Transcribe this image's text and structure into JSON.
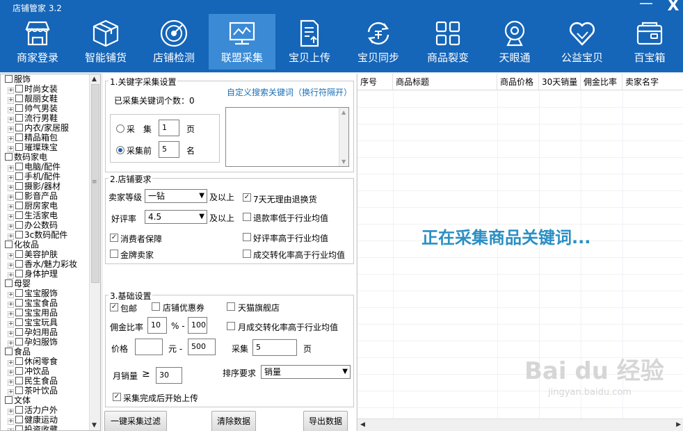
{
  "app": {
    "title": "店铺管家  3.2",
    "minimize": "—",
    "close": "X"
  },
  "toolbar": [
    {
      "label": "商家登录",
      "icon": "shop-icon"
    },
    {
      "label": "智能铺货",
      "icon": "box-icon"
    },
    {
      "label": "店铺检测",
      "icon": "radar-icon"
    },
    {
      "label": "联盟采集",
      "icon": "monitor-chart-icon",
      "active": true
    },
    {
      "label": "宝贝上传",
      "icon": "document-upload-icon"
    },
    {
      "label": "宝贝同步",
      "icon": "sync-icon"
    },
    {
      "label": "商品裂变",
      "icon": "grid-icon"
    },
    {
      "label": "天眼通",
      "icon": "webcam-icon"
    },
    {
      "label": "公益宝贝",
      "icon": "heart-icon"
    },
    {
      "label": "百宝箱",
      "icon": "wallet-icon"
    }
  ],
  "tree": [
    {
      "label": "服饰",
      "children": [
        "时尚女装",
        "靓丽女鞋",
        "帅气男装",
        "流行男鞋",
        "内衣/家居服",
        "精品箱包",
        "璀璨珠宝"
      ]
    },
    {
      "label": "数码家电",
      "children": [
        "电脑/配件",
        "手机/配件",
        "摄影/器材",
        "影音产品",
        "厨房家电",
        "生活家电",
        "办公数码",
        "3c数码配件"
      ]
    },
    {
      "label": "化妆品",
      "children": [
        "美容护肤",
        "香水/魅力彩妆",
        "身体护理"
      ]
    },
    {
      "label": "母婴",
      "children": [
        "宝宝服饰",
        "宝宝食品",
        "宝宝用品",
        "宝宝玩具",
        "孕妇用品",
        "孕妇服饰"
      ]
    },
    {
      "label": "食品",
      "children": [
        "休闲零食",
        "冲饮品",
        "民生食品",
        "茶叶饮品"
      ]
    },
    {
      "label": "文体",
      "children": [
        "活力户外",
        "健康运动",
        "投资收藏"
      ]
    }
  ],
  "keyword": {
    "title": "1.关键字采集设置",
    "custom_link": "自定义搜索关键词（换行符隔开）",
    "count_label": "已采集关键词个数：0",
    "opt1_label": "采　集",
    "opt1_value": "1",
    "opt1_unit": "页",
    "opt2_label": "采集前",
    "opt2_value": "5",
    "opt2_unit": "名"
  },
  "shop": {
    "title": "2.店铺要求",
    "level_label": "卖家等级",
    "level_value": "一钻",
    "above1": "及以上",
    "rate_label": "好评率",
    "rate_value": "4.5",
    "above2": "及以上",
    "consumer": "消费者保障",
    "gold": "金牌卖家",
    "return7": "7天无理由退换货",
    "refund": "退款率低于行业均值",
    "goodrate": "好评率高于行业均值",
    "conv": "成交转化率高于行业均值"
  },
  "basic": {
    "title": "3.基础设置",
    "free_ship": "包邮",
    "coupon": "店铺优惠券",
    "tmall": "天猫旗舰店",
    "commission_label": "佣金比率",
    "comm_min": "10",
    "percent_dash": "% -",
    "comm_max": "100",
    "monthly_conv": "月成交转化率高于行业均值",
    "price_label": "价格",
    "price_min": "",
    "yuan_dash": "元 -",
    "price_max": "500",
    "collect_label": "采集",
    "collect_value": "5",
    "collect_unit": "页",
    "sales_label": "月销量",
    "gte": "≥",
    "sales_value": "30",
    "sort_label": "排序要求",
    "sort_value": "销量",
    "upload_after": "采集完成后开始上传"
  },
  "buttons": {
    "filter": "一键采集过滤",
    "clear": "清除数据",
    "export": "导出数据"
  },
  "table": {
    "columns": [
      "序号",
      "商品标题",
      "商品价格",
      "30天销量",
      "佣金比率",
      "卖家名字"
    ],
    "status": "正在采集商品关键词..."
  },
  "watermark": {
    "main": "Bai du 经验",
    "sub": "jingyan.baidu.com"
  },
  "colors": {
    "topbar": "#1565b8",
    "active_tab": "#3a8ad6",
    "status": "#2a8fc4",
    "link": "#1a6fb5"
  }
}
